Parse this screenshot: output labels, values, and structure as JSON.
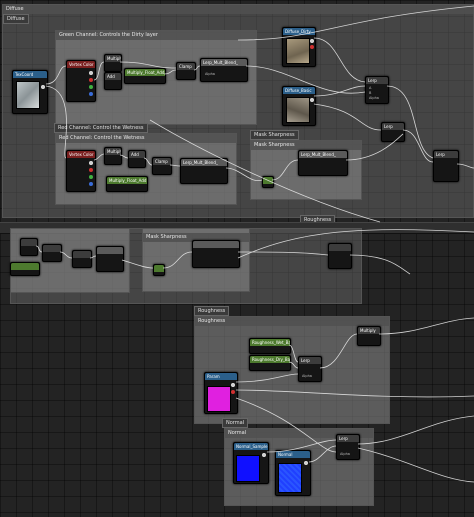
{
  "groups": {
    "diffuse": "Diffuse",
    "diffuse_inner": "Diffuse",
    "green_channel": "Green Channel: Controls the Dirty layer",
    "red_channel": "Red Channel: Control the Wetness",
    "mask_sharpness": "Mask Sharpness",
    "mask_sharpness_2": "Mask Sharpness",
    "roughness": "Roughness",
    "roughness_inner": "Roughness",
    "normal": "Normal",
    "normal_inner": "Normal"
  },
  "nodes": {
    "texcoord": "TexCoord",
    "mask_tex": "Vertex Color",
    "mask_tex2": "Vertex Color",
    "mult_dirt": "Multiply_Float_Add",
    "mult_wet": "Multiply_Float_Add",
    "clamp1": "Clamp",
    "clamp2": "Clamp",
    "lerp_sat1": "Lerp_Mult_Blend_",
    "lerp_sat2": "Lerp_Mult_Blend_",
    "lerp_sat3": "Lerp_Mult_Blend_",
    "diffuse_dirty": "Diffuse_Dirty",
    "diffuse_basic": "Diffuse_Basic",
    "lerp_a": "Lerp",
    "lerp_b": "Lerp",
    "lerp_c": "Lerp",
    "multiply": "Multiply",
    "roughness_a": "Roughness_Wet_Base",
    "roughness_b": "Roughness_Dry_Base",
    "lerp_rough": "Lerp",
    "multiply_r": "Multiply",
    "rough_param": "Param",
    "normal_sample": "Normal_Sample",
    "normal_tex": "Normal",
    "lerp_normal": "Lerp",
    "add_small": "Add"
  },
  "pin_labels": {
    "a": "A",
    "b": "B",
    "alpha": "Alpha",
    "exp": "Exp"
  },
  "colors": {
    "comment_bg": "#8c8c8c",
    "node_bg": "#151515",
    "blue_header": "#2b5f8a",
    "green_header": "#4d7a2e",
    "rough_swatch": "#e020e0",
    "normal_swatch_a": "#1010ff",
    "normal_swatch_b": "#2040ff"
  }
}
